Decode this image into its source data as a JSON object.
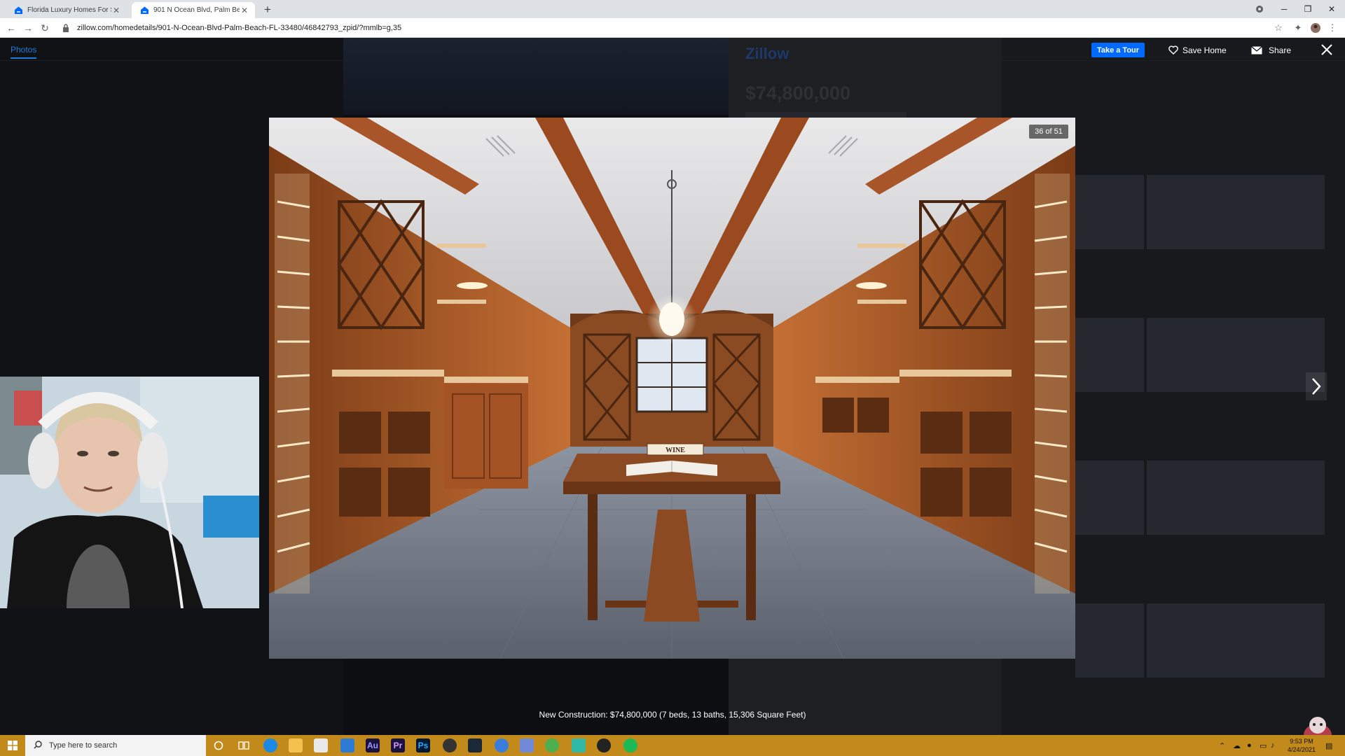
{
  "browser": {
    "tabs": [
      {
        "title": "Florida Luxury Homes For Sale -",
        "active": false
      },
      {
        "title": "901 N Ocean Blvd, Palm Beach, F",
        "active": true
      }
    ],
    "url": "zillow.com/homedetails/901-N-Ocean-Blvd-Palm-Beach-FL-33480/46842793_zpid/?mmlb=g,35"
  },
  "viewer": {
    "tab_photos": "Photos",
    "take_tour": "Take a Tour",
    "save_home": "Save Home",
    "share": "Share",
    "counter": "36 of 51",
    "caption": "New Construction: $74,800,000 (7 beds, 13 baths, 15,306 Square Feet)"
  },
  "background": {
    "logo": "Zillow",
    "price": "$74,800,000"
  },
  "photo_content": {
    "table_sign": "WINE"
  },
  "taskbar": {
    "search_placeholder": "Type here to search",
    "time": "9:53 PM",
    "date": "4/24/2021",
    "app_labels": [
      "Au",
      "Pr",
      "Ps"
    ]
  },
  "colors": {
    "accent": "#006aff",
    "link": "#1d7bdc",
    "taskbar": "#c18a1a"
  }
}
